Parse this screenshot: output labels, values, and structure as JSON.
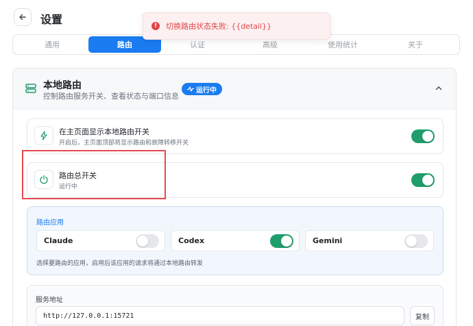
{
  "header": {
    "title": "设置",
    "back_icon": "arrow-left-icon"
  },
  "toast": {
    "type": "error",
    "message": "切换路由状态失败: {{detail}}",
    "color": "#e0454a"
  },
  "tabs": [
    {
      "label": "通用",
      "active": false
    },
    {
      "label": "路由",
      "active": true
    },
    {
      "label": "认证",
      "active": false
    },
    {
      "label": "高级",
      "active": false
    },
    {
      "label": "使用统计",
      "active": false
    },
    {
      "label": "关于",
      "active": false
    }
  ],
  "section": {
    "title": "本地路由",
    "subtitle": "控制路由服务开关、查看状态与端口信息",
    "status_badge": "运行中",
    "icon": "server-icon",
    "expanded": true
  },
  "settings": [
    {
      "title": "在主页面显示本地路由开关",
      "subtitle": "开启后，主页面顶部将显示路由和故障转移开关",
      "icon": "bolt-icon",
      "enabled": true
    },
    {
      "title": "路由总开关",
      "subtitle": "运行中",
      "icon": "power-icon",
      "enabled": true
    }
  ],
  "apps": {
    "label": "路由应用",
    "items": [
      {
        "name": "Claude",
        "enabled": false
      },
      {
        "name": "Codex",
        "enabled": true
      },
      {
        "name": "Gemini",
        "enabled": false
      }
    ],
    "hint": "选择要路由的应用，启用后该应用的请求将通过本地路由转发"
  },
  "address": {
    "label": "服务地址",
    "value": "http://127.0.0.1:15721",
    "copy_label": "复制"
  },
  "colors": {
    "accent": "#1a7cf0",
    "toggle_on": "#1f9d6b",
    "error": "#e0454a",
    "highlight_box": "#e5484d"
  }
}
